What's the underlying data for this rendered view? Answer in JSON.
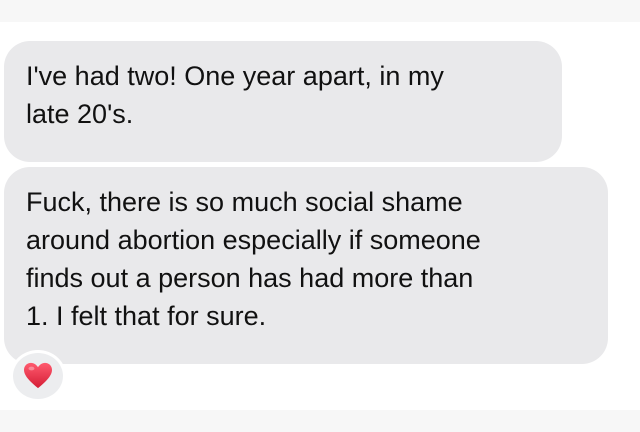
{
  "messages": [
    {
      "text": "I've had two! One year apart, in my\nlate 20's."
    },
    {
      "text": "Fuck, there is so much social shame\naround abortion especially if someone\nfinds out a person has had more than\n1. I felt that for sure."
    }
  ],
  "reaction": {
    "icon": "red-heart-icon",
    "color": "#e0263c"
  },
  "colors": {
    "bubble": "#e9e9eb",
    "background": "#ffffff",
    "text": "#111111"
  }
}
